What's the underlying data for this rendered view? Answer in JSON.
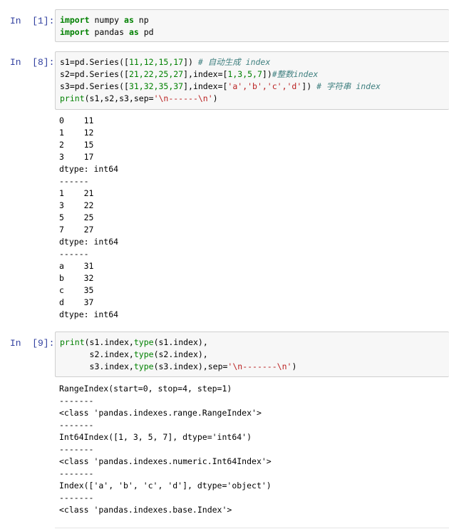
{
  "cells": [
    {
      "prompt": "In  [1]:",
      "code": {
        "l1_kw": "import",
        "l1_mod": " numpy ",
        "l1_as": "as",
        "l1_alias": " np",
        "l2_kw": "import",
        "l2_mod": " pandas ",
        "l2_as": "as",
        "l2_alias": " pd"
      }
    },
    {
      "prompt": "In  [8]:",
      "code": {
        "l1_a": "s1=pd.Series([",
        "l1_n": "11,12,15,17",
        "l1_b": "]) ",
        "l1_c": "# 自动生成 index",
        "l2_a": "s2=pd.Series([",
        "l2_n": "21,22,25,27",
        "l2_b": "],index=[",
        "l2_n2": "1,3,5,7",
        "l2_c": "])",
        "l2_com": "#整数index",
        "l3_a": "s3=pd.Series([",
        "l3_n": "31,32,35,37",
        "l3_b": "],index=[",
        "l3_s": "'a','b','c','d'",
        "l3_c": "]) ",
        "l3_com": "# 字符串 index",
        "l4_fn": "print",
        "l4_a": "(s1,s2,s3,sep=",
        "l4_s": "'\\n------\\n'",
        "l4_b": ")"
      },
      "output": [
        "0    11",
        "1    12",
        "2    15",
        "3    17",
        "dtype: int64",
        "------",
        "1    21",
        "3    22",
        "5    25",
        "7    27",
        "dtype: int64",
        "------",
        "a    31",
        "b    32",
        "c    35",
        "d    37",
        "dtype: int64"
      ]
    },
    {
      "prompt": "In  [9]:",
      "code": {
        "l1_fn": "print",
        "l1_a": "(s1.index,",
        "l1_t": "type",
        "l1_b": "(s1.index),",
        "l2_a": "      s2.index,",
        "l2_t": "type",
        "l2_b": "(s2.index),",
        "l3_a": "      s3.index,",
        "l3_t": "type",
        "l3_b": "(s3.index),sep=",
        "l3_s": "'\\n-------\\n'",
        "l3_c": ")"
      },
      "output": [
        "RangeIndex(start=0, stop=4, step=1)",
        "-------",
        "<class 'pandas.indexes.range.RangeIndex'>",
        "-------",
        "Int64Index([1, 3, 5, 7], dtype='int64')",
        "-------",
        "<class 'pandas.indexes.numeric.Int64Index'>",
        "-------",
        "Index(['a', 'b', 'c', 'd'], dtype='object')",
        "-------",
        "<class 'pandas.indexes.base.Index'>"
      ]
    }
  ]
}
